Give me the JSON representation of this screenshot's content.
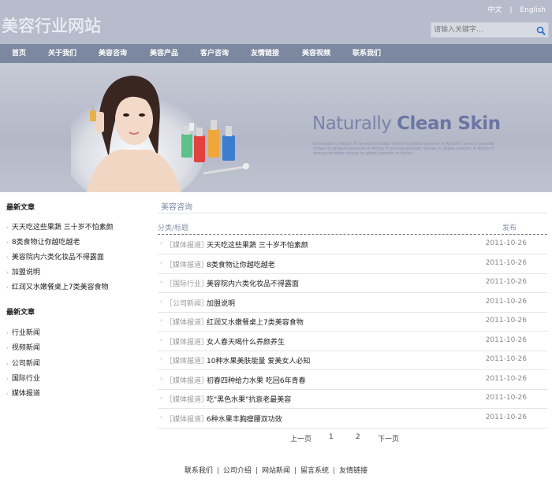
{
  "header": {
    "logo": "美容行业网站",
    "lang_cn": "中文",
    "lang_sep": "|",
    "lang_en": "English",
    "search_placeholder": "请输入关键字..."
  },
  "nav": [
    "首页",
    "关于我们",
    "美容咨询",
    "美容产品",
    "客户咨询",
    "友情链接",
    "美容视频",
    "联系我们"
  ],
  "banner": {
    "title_light": "Naturally ",
    "title_bold": "Clean Skin",
    "subtitle": "Innovation in Action IT service provider strives to global premier in ActionIT service provider strives to globalInnovation in Action IT service provider strives to global premier in Action IT service provider strives to global premier in Action"
  },
  "sidebar": {
    "section1_title": "最新文章",
    "section1_items": [
      "天天吃这些果蔬 三十岁不怕素颜",
      "8类食物让你越吃越老",
      "美容院内六类化妆品不得露面",
      "加盟说明",
      "红润又水嫩餐桌上7类美容食物"
    ],
    "section2_title": "最新文章",
    "section2_items": [
      "行业新闻",
      "视频新闻",
      "公司新闻",
      "国际行业",
      "媒体报道"
    ]
  },
  "main": {
    "title": "美容咨询",
    "col_category": "分类/标题",
    "col_date": "发布",
    "rows": [
      {
        "cat": "［媒体报道］",
        "title": "天天吃这些果蔬 三十岁不怕素颜",
        "date": "2011-10-26"
      },
      {
        "cat": "［媒体报道］",
        "title": "8类食物让你越吃越老",
        "date": "2011-10-26"
      },
      {
        "cat": "［国际行业］",
        "title": "美容院内六类化妆品不得露面",
        "date": "2011-10-26"
      },
      {
        "cat": "［公司新闻］",
        "title": "加盟说明",
        "date": "2011-10-26"
      },
      {
        "cat": "［媒体报道］",
        "title": "红润又水嫩餐桌上7类美容食物",
        "date": "2011-10-26"
      },
      {
        "cat": "［媒体报道］",
        "title": "女人春天喝什么养颜养生",
        "date": "2011-10-26"
      },
      {
        "cat": "［媒体报道］",
        "title": "10种水果美肤能量 爱美女人必知",
        "date": "2011-10-26"
      },
      {
        "cat": "［媒体报道］",
        "title": "初春四种给力水果 吃回6年青春",
        "date": "2011-10-26"
      },
      {
        "cat": "［媒体报道］",
        "title": "吃\"黑色水果\"抗衰老最美容",
        "date": "2011-10-26"
      },
      {
        "cat": "［媒体报道］",
        "title": "6种水果丰胸瘦腰双功效",
        "date": "2011-10-26"
      }
    ],
    "pager": {
      "prev": "上一页",
      "p1": "1",
      "p2": "2",
      "next": "下一页"
    }
  },
  "footer": {
    "links": [
      "联系我们",
      "公司介绍",
      "网站新闻",
      "留言系统",
      "友情链接"
    ],
    "sep": "|"
  }
}
